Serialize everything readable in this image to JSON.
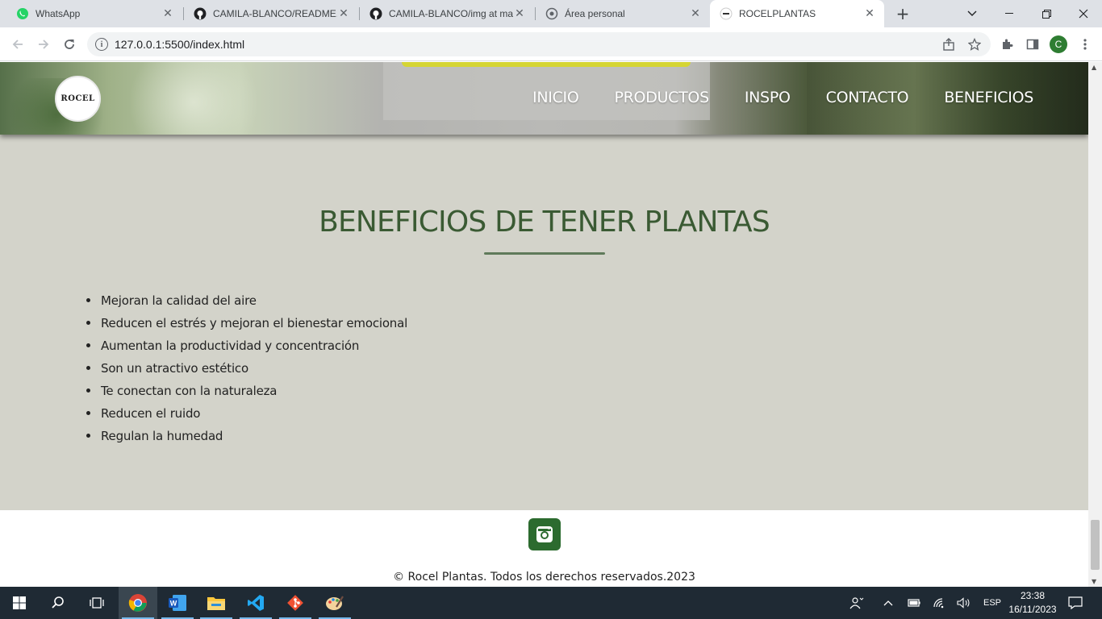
{
  "browser": {
    "tabs": [
      {
        "title": "WhatsApp",
        "icon": "whatsapp-icon"
      },
      {
        "title": "CAMILA-BLANCO/README.md",
        "icon": "github-icon"
      },
      {
        "title": "CAMILA-BLANCO/img at main",
        "icon": "github-icon"
      },
      {
        "title": "Área personal",
        "icon": "moodle-icon"
      },
      {
        "title": "ROCELPLANTAS",
        "icon": "rocel-favicon"
      }
    ],
    "address": "127.0.0.1:5500/index.html",
    "profile_initial": "C"
  },
  "page": {
    "logo_text": "ROCEL",
    "nav": [
      "INICIO",
      "PRODUCTOS",
      "INSPO",
      "CONTACTO",
      "BENEFICIOS"
    ],
    "section_title": "BENEFICIOS DE TENER PLANTAS",
    "benefits": [
      "Mejoran la calidad del aire",
      "Reducen el estrés y mejoran el bienestar emocional",
      "Aumentan la productividad y concentración",
      "Son un atractivo estético",
      "Te conectan con la naturaleza",
      "Reducen el ruido",
      "Regulan la humedad"
    ],
    "footer_copyright": "© Rocel Plantas. Todos los derechos reservados.2023"
  },
  "taskbar": {
    "language": "ESP",
    "time": "23:38",
    "date": "16/11/2023"
  },
  "colors": {
    "section_bg": "#d3d3ca",
    "title_green": "#3a5a33",
    "instagram_green": "#2c6b2f"
  }
}
